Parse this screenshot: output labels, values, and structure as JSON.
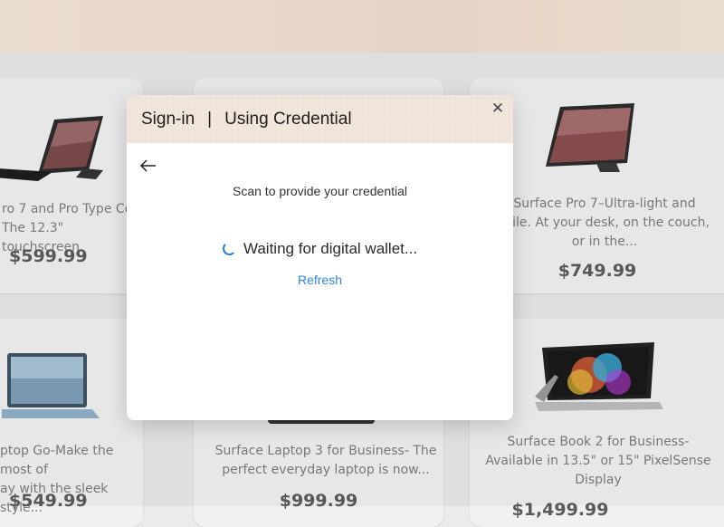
{
  "modal": {
    "title": "Sign-in",
    "separator": "|",
    "subtitle": "Using Credential",
    "close_icon": "close-icon",
    "back_icon": "back-arrow-icon",
    "scan_text": "Scan to provide your credential",
    "waiting_text": "Waiting for digital wallet...",
    "refresh_label": "Refresh",
    "accent_color": "#2f86d6"
  },
  "products": [
    {
      "desc": "ro 7 and Pro Type Co\nThe 12.3\" touchscreen",
      "price": "$599.99"
    },
    {
      "desc": "",
      "price": ""
    },
    {
      "desc": "Surface Pro 7–Ultra-light and\natile. At your desk, on the couch,\nor in the...",
      "price": "$749.99"
    },
    {
      "desc": "ptop Go-Make the most of\nay with the sleek style...",
      "price": "$549.99"
    },
    {
      "desc": "Surface Laptop 3 for Business- The\nperfect everyday laptop is now...",
      "price": "$999.99"
    },
    {
      "desc": "Surface Book 2 for Business-\nAvailable in 13.5\" or 15\" PixelSense\nDisplay",
      "price": "$1,499.99"
    }
  ]
}
